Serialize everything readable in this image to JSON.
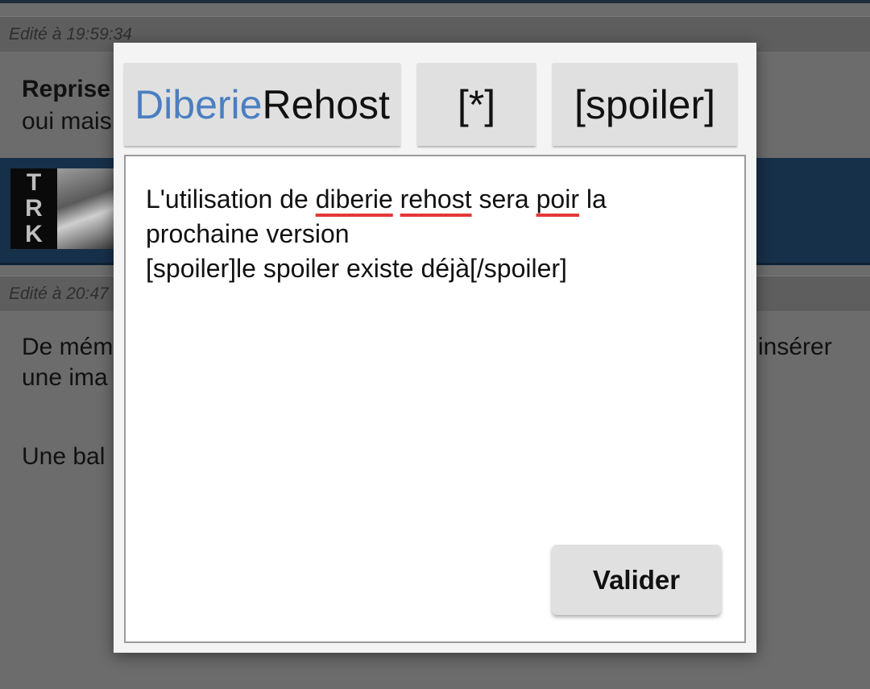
{
  "background": {
    "post1": {
      "edit_note": "Edité à 19:59:34",
      "quote_title": "Reprise",
      "quote_text": "oui mais"
    },
    "signature_banner": {
      "logo_letters": [
        "T",
        "R",
        "K"
      ]
    },
    "post2": {
      "edit_note": "Edité à 20:47",
      "text_line1_left": "De mém",
      "text_line1_right": "insérer",
      "text_line2": "une ima",
      "text_line3": "Une bal"
    }
  },
  "dialog": {
    "toolbar": {
      "rehost_label_part1": "Diberie",
      "rehost_label_part2": "Rehost",
      "list_label": "[*]",
      "spoiler_label": "[spoiler]"
    },
    "editor": {
      "line1": [
        "L'utilisation de ",
        "diberie",
        " ",
        "rehost",
        " sera ",
        "poir",
        " la"
      ],
      "line2": "prochaine version",
      "line3": "[spoiler]le spoiler existe déjà[/spoiler]"
    },
    "submit_label": "Valider"
  },
  "colors": {
    "overlay_background": "#6c6c6c",
    "brand_blue": "#4a7fc1",
    "spellcheck_underline": "#e53935",
    "banner": "#173049"
  }
}
